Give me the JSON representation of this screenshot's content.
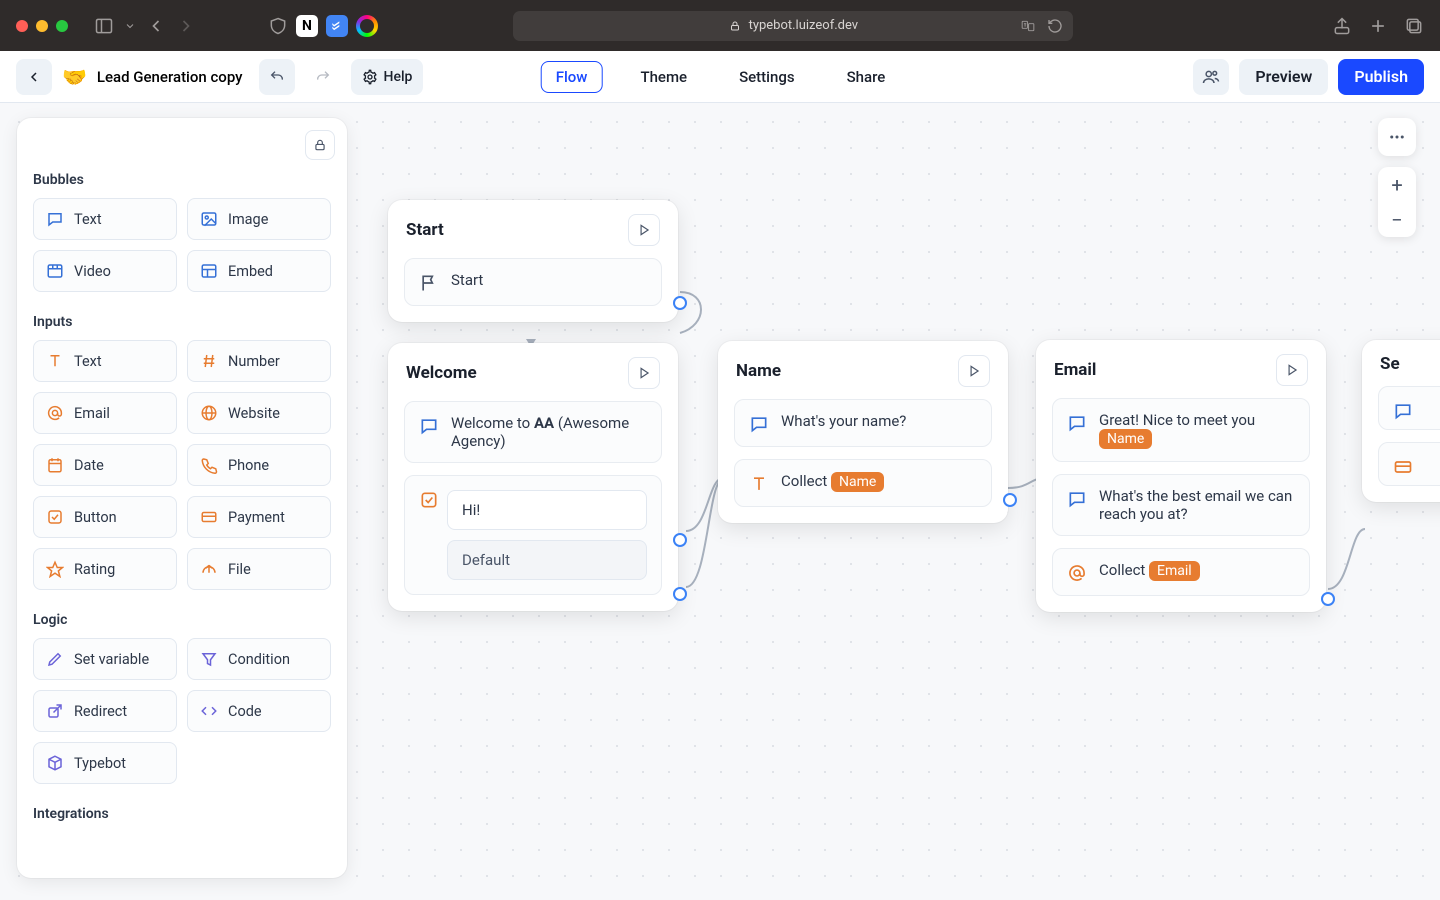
{
  "browser": {
    "url_host": "typebot.luizeof.dev"
  },
  "header": {
    "bot_emoji": "🤝",
    "bot_name": "Lead Generation copy",
    "help_label": "Help",
    "tabs": {
      "flow": "Flow",
      "theme": "Theme",
      "settings": "Settings",
      "share": "Share"
    },
    "preview": "Preview",
    "publish": "Publish"
  },
  "sidebar": {
    "sections": {
      "bubbles": "Bubbles",
      "inputs": "Inputs",
      "logic": "Logic",
      "integrations": "Integrations"
    },
    "bubbles": {
      "text": "Text",
      "image": "Image",
      "video": "Video",
      "embed": "Embed"
    },
    "inputs": {
      "text": "Text",
      "number": "Number",
      "email": "Email",
      "website": "Website",
      "date": "Date",
      "phone": "Phone",
      "button": "Button",
      "payment": "Payment",
      "rating": "Rating",
      "file": "File"
    },
    "logic": {
      "setvar": "Set variable",
      "condition": "Condition",
      "redirect": "Redirect",
      "code": "Code",
      "typebot": "Typebot"
    }
  },
  "nodes": {
    "start": {
      "title": "Start",
      "row": "Start"
    },
    "welcome": {
      "title": "Welcome",
      "line_pre": "Welcome to ",
      "line_bold": "AA",
      "line_post": " (Awesome Agency)",
      "opt1": "Hi!",
      "opt2": "Default"
    },
    "name": {
      "title": "Name",
      "ask": "What's your name?",
      "collect": "Collect ",
      "var": "Name"
    },
    "email": {
      "title": "Email",
      "greet_pre": "Great! Nice to meet you ",
      "greet_var": "Name",
      "ask": "What's the best email we can reach you at?",
      "collect": "Collect ",
      "var": "Email"
    },
    "peek": {
      "title": "Se"
    }
  }
}
